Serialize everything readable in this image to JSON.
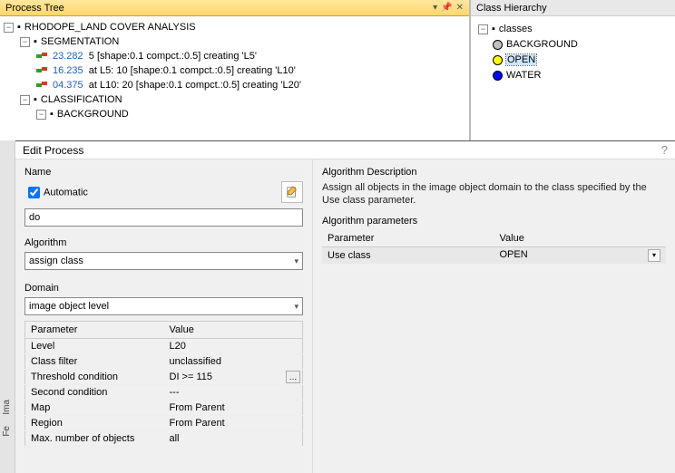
{
  "processTree": {
    "title": "Process Tree",
    "root": "RHODOPE_LAND COVER ANALYSIS",
    "segmentation": {
      "label": "SEGMENTATION",
      "items": [
        {
          "num": "23.282",
          "text": "5 [shape:0.1 compct.:0.5] creating 'L5'"
        },
        {
          "num": "16.235",
          "text": "at  L5: 10 [shape:0.1 compct.:0.5] creating 'L10'"
        },
        {
          "num": "04.375",
          "text": "at  L10: 20 [shape:0.1 compct.:0.5] creating 'L20'"
        }
      ]
    },
    "classification": {
      "label": "CLASSIFICATION",
      "children": [
        {
          "label": "BACKGROUND"
        }
      ]
    }
  },
  "classHierarchy": {
    "title": "Class Hierarchy",
    "root": "classes",
    "items": [
      {
        "label": "BACKGROUND",
        "color": "#c0c0c0"
      },
      {
        "label": "OPEN",
        "color": "#ffff00",
        "selected": true
      },
      {
        "label": "WATER",
        "color": "#0000ff"
      }
    ]
  },
  "dialog": {
    "title": "Edit Process",
    "name": {
      "label": "Name",
      "automatic": "Automatic",
      "value": "do"
    },
    "algorithm": {
      "label": "Algorithm",
      "value": "assign class"
    },
    "domain": {
      "label": "Domain",
      "value": "image object level",
      "paramHeader": "Parameter",
      "valueHeader": "Value",
      "params": [
        {
          "p": "Level",
          "v": "L20"
        },
        {
          "p": "Class filter",
          "v": "unclassified"
        },
        {
          "p": "Threshold condition",
          "v": "DI >= 115",
          "browse": true
        },
        {
          "p": "Second condition",
          "v": "---"
        },
        {
          "p": "Map",
          "v": "From Parent"
        },
        {
          "p": "Region",
          "v": "From Parent"
        },
        {
          "p": "Max. number of objects",
          "v": "all"
        }
      ]
    },
    "algDesc": {
      "label": "Algorithm Description",
      "text": "Assign all objects in the image object domain to the class specified by the Use class parameter."
    },
    "algParams": {
      "label": "Algorithm parameters",
      "paramHeader": "Parameter",
      "valueHeader": "Value",
      "rows": [
        {
          "p": "Use class",
          "v": "OPEN",
          "selected": true
        }
      ]
    }
  },
  "sideTabs": {
    "ima": "Ima",
    "fe": "Fe"
  }
}
